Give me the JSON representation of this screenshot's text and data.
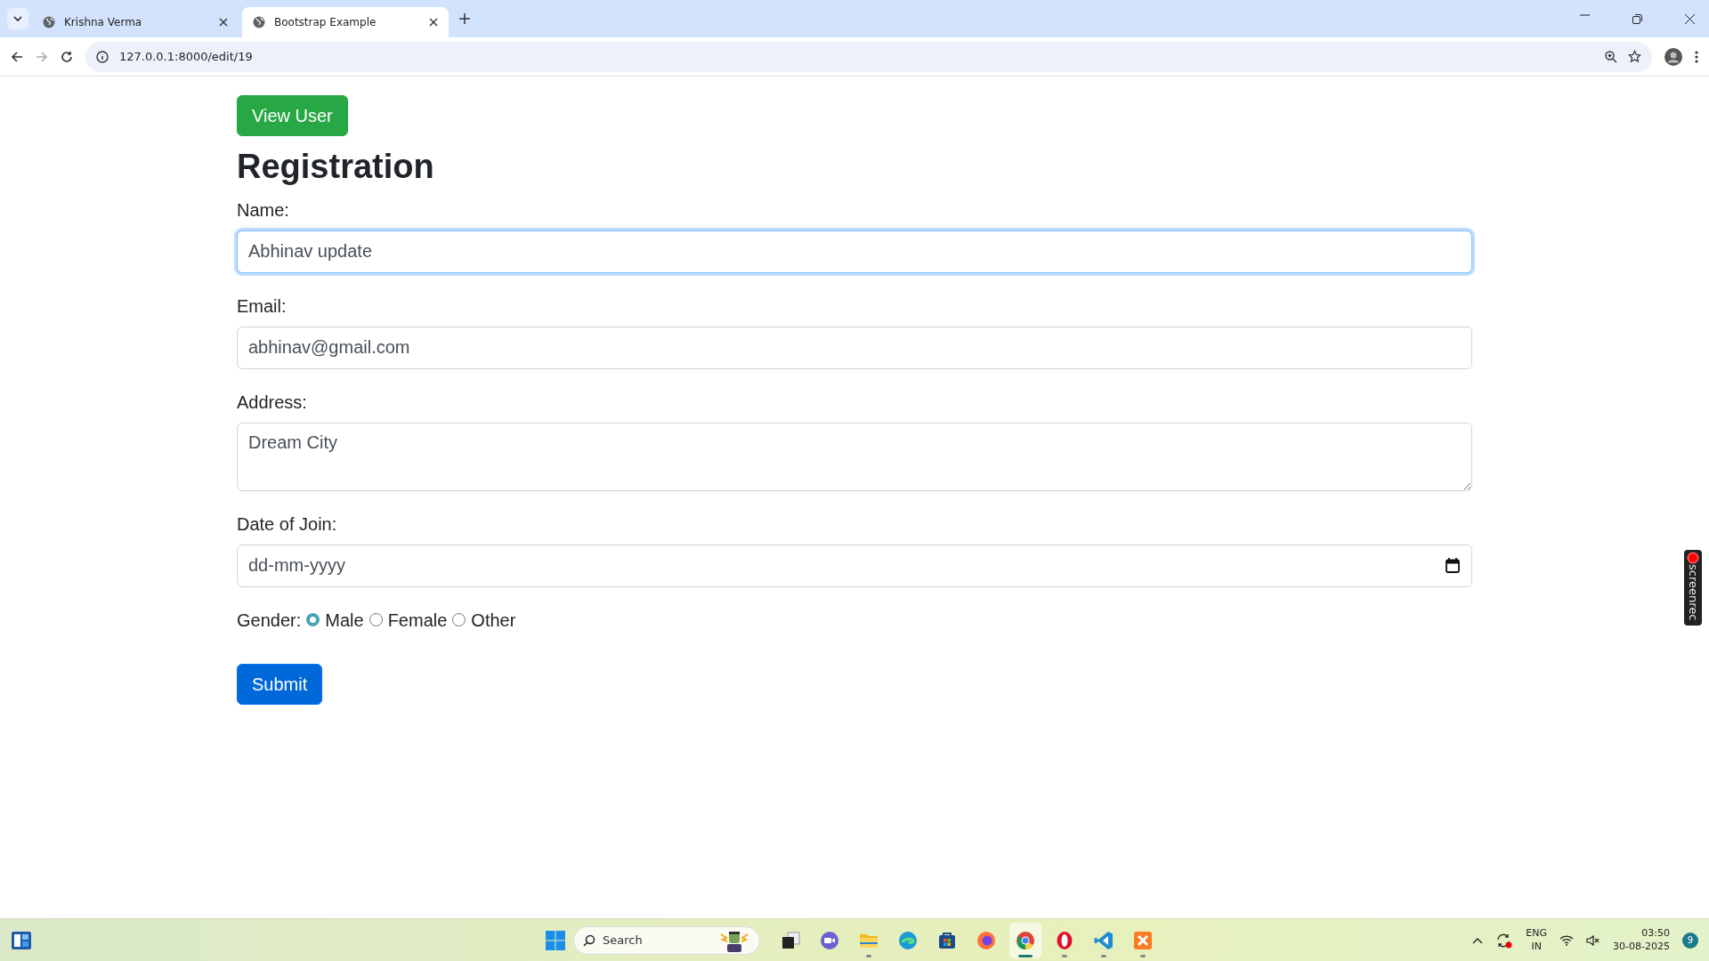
{
  "browser": {
    "tabs": [
      {
        "title": "Krishna Verma",
        "selected": false
      },
      {
        "title": "Bootstrap Example",
        "selected": true
      }
    ],
    "address": "127.0.0.1:8000/edit/19"
  },
  "page": {
    "view_button": "View User",
    "heading": "Registration",
    "fields": [
      {
        "kind": "input",
        "label": "Name:",
        "value": "Abhinav update",
        "focused": true
      },
      {
        "kind": "input",
        "label": "Email:",
        "value": "abhinav@gmail.com",
        "focused": false
      },
      {
        "kind": "textarea",
        "label": "Address:",
        "value": "Dream City",
        "focused": false
      },
      {
        "kind": "date",
        "label": "Date of Join:",
        "placeholder": "dd-mm-yyyy",
        "focused": false
      }
    ],
    "gender": {
      "label": "Gender:",
      "options": [
        {
          "label": "Male",
          "selected": true
        },
        {
          "label": "Female",
          "selected": false
        },
        {
          "label": "Other",
          "selected": false
        }
      ]
    },
    "submit": "Submit"
  },
  "recorder": {
    "label": "screenrec"
  },
  "taskbar": {
    "search_placeholder": "Search",
    "apps": [
      {
        "kind": "taskview",
        "running": false,
        "selected": false
      },
      {
        "kind": "meet",
        "running": false,
        "selected": false
      },
      {
        "kind": "files",
        "running": true,
        "selected": false
      },
      {
        "kind": "edge",
        "running": false,
        "selected": false
      },
      {
        "kind": "store",
        "running": false,
        "selected": false
      },
      {
        "kind": "firefox",
        "running": false,
        "selected": false
      },
      {
        "kind": "chrome",
        "running": true,
        "selected": true
      },
      {
        "kind": "opera",
        "running": true,
        "selected": false
      },
      {
        "kind": "vscode",
        "running": true,
        "selected": false
      },
      {
        "kind": "xampp",
        "running": true,
        "selected": false
      }
    ],
    "language": "ENG",
    "region": "IN",
    "time": "03:50",
    "date": "30-08-2025",
    "notifications": "9"
  }
}
